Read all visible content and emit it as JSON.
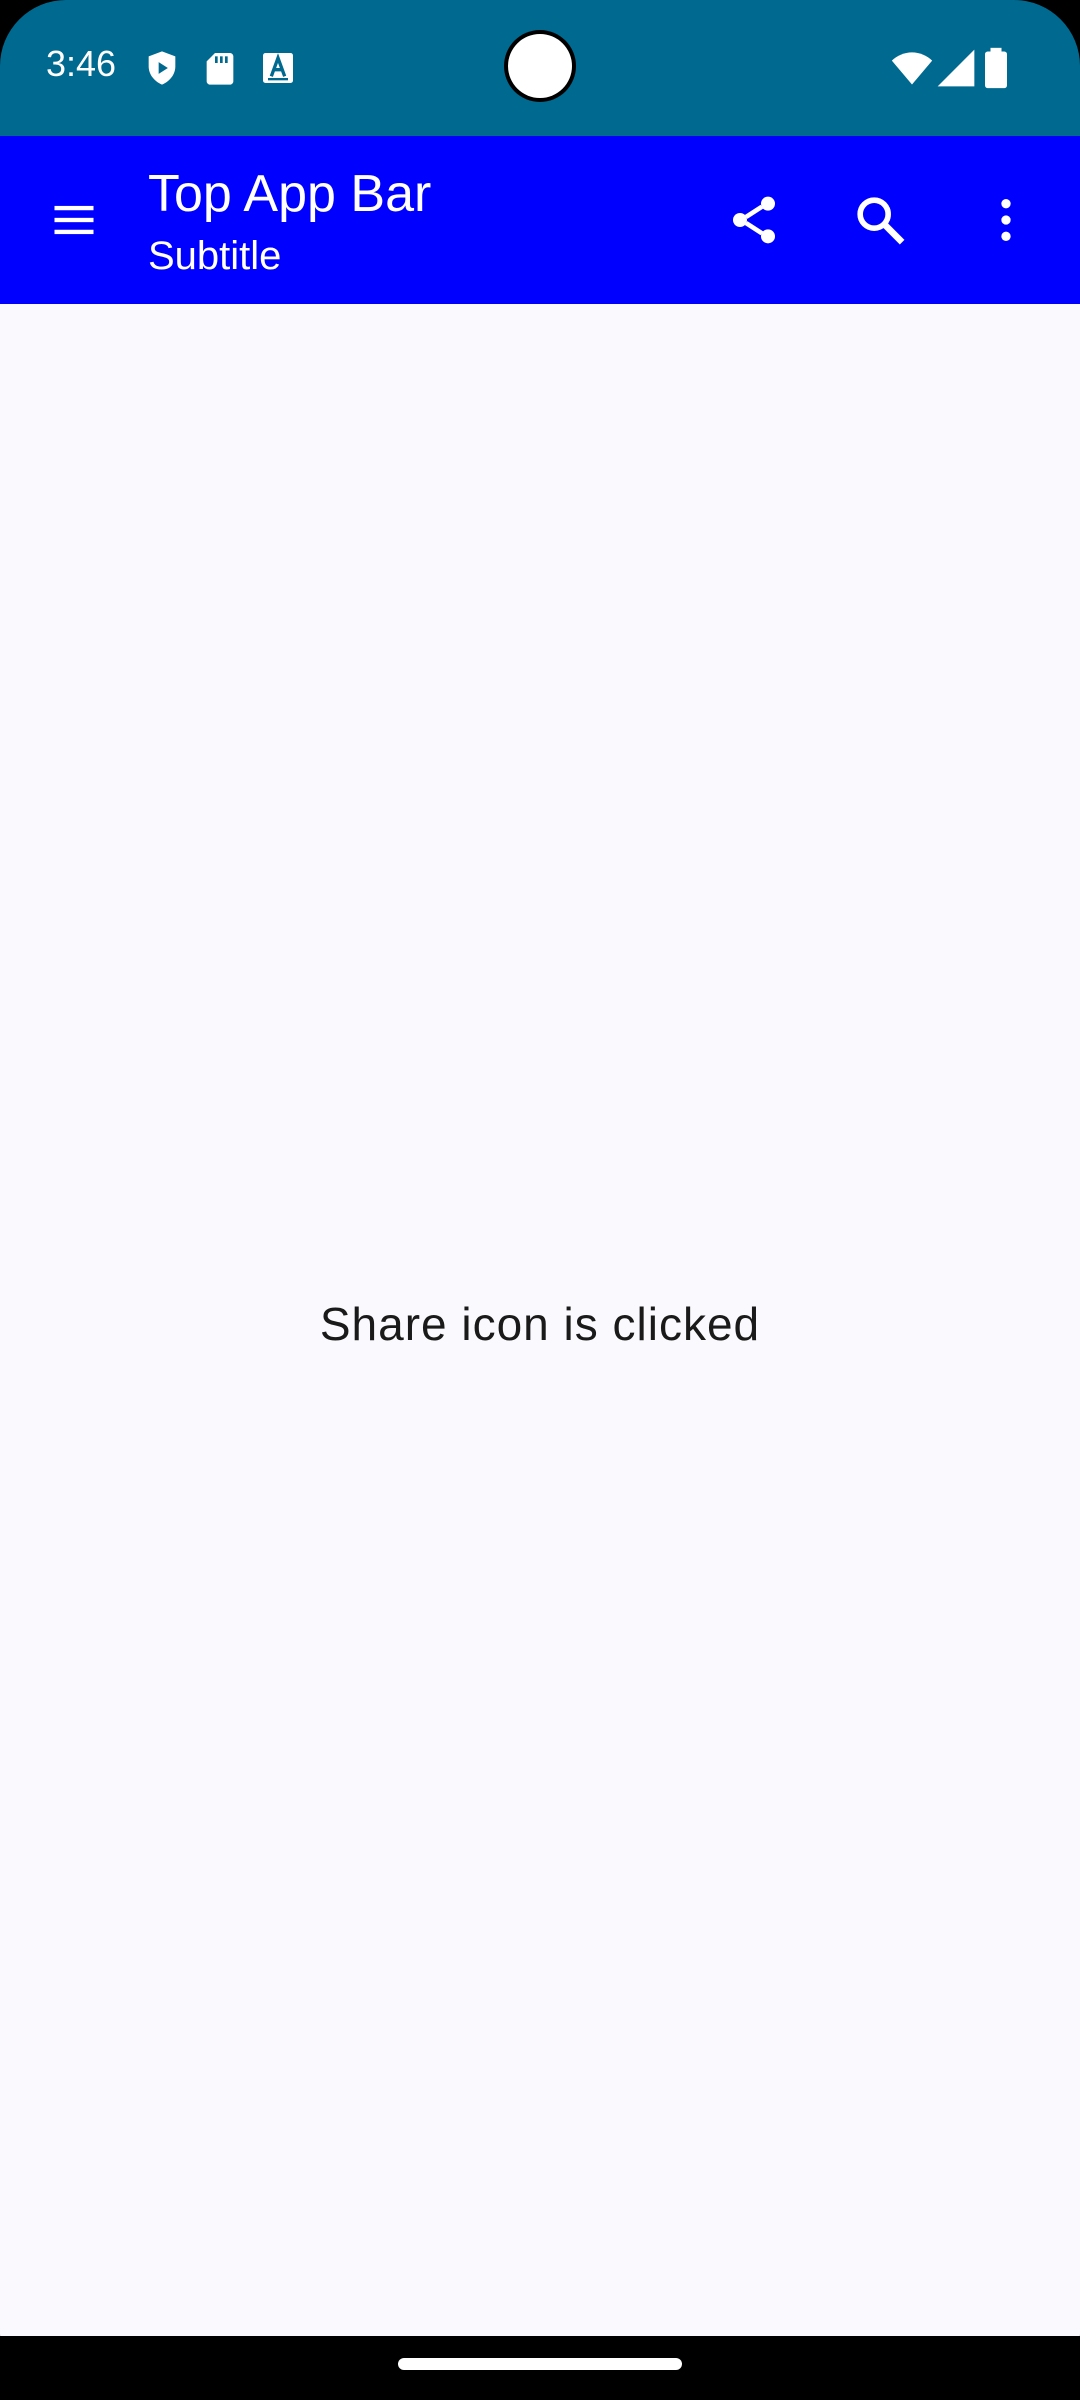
{
  "status_bar": {
    "time": "3:46",
    "background_color": "#00698f",
    "left_icons": [
      "shield-icon",
      "sd-card-icon",
      "keyboard-a-icon"
    ],
    "right_icons": [
      "wifi-icon",
      "cellular-signal-icon",
      "battery-icon"
    ]
  },
  "app_bar": {
    "title": "Top App Bar",
    "subtitle": "Subtitle",
    "background_color": "#0000ff",
    "navigation_icon": "menu-icon",
    "action_icons": [
      "share-icon",
      "search-icon",
      "more-vert-icon"
    ]
  },
  "content": {
    "message": "Share icon is clicked",
    "background_color": "#fafafe"
  },
  "navigation_bar": {
    "handle": "gesture-handle"
  }
}
